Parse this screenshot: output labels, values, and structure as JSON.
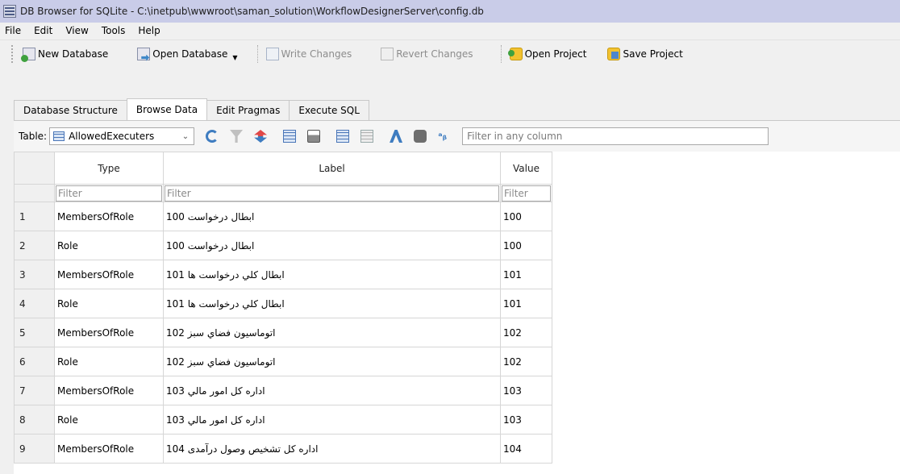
{
  "window": {
    "title": "DB Browser for SQLite - C:\\inetpub\\wwwroot\\saman_solution\\WorkflowDesignerServer\\config.db"
  },
  "menu": [
    "File",
    "Edit",
    "View",
    "Tools",
    "Help"
  ],
  "toolbar": {
    "new_database": "New Database",
    "open_database": "Open Database",
    "write_changes": "Write Changes",
    "revert_changes": "Revert Changes",
    "open_project": "Open Project",
    "save_project": "Save Project"
  },
  "tabs": [
    "Database Structure",
    "Browse Data",
    "Edit Pragmas",
    "Execute SQL"
  ],
  "active_tab": "Browse Data",
  "browse": {
    "table_label": "Table:",
    "table_selected": "AllowedExecuters",
    "filter_any_placeholder": "Filter in any column"
  },
  "grid": {
    "columns": [
      "Type",
      "Label",
      "Value"
    ],
    "filter_placeholder": "Filter",
    "rows": [
      {
        "num": "1",
        "type": "MembersOfRole",
        "label": "ابطال درخواست 100",
        "value": "100"
      },
      {
        "num": "2",
        "type": "Role",
        "label": "ابطال درخواست 100",
        "value": "100"
      },
      {
        "num": "3",
        "type": "MembersOfRole",
        "label": "ابطال کلي درخواست ها 101",
        "value": "101"
      },
      {
        "num": "4",
        "type": "Role",
        "label": "ابطال کلي درخواست ها 101",
        "value": "101"
      },
      {
        "num": "5",
        "type": "MembersOfRole",
        "label": "اتوماسيون فضاي سبز 102",
        "value": "102"
      },
      {
        "num": "6",
        "type": "Role",
        "label": "اتوماسيون فضاي سبز 102",
        "value": "102"
      },
      {
        "num": "7",
        "type": "MembersOfRole",
        "label": "اداره کل امور مالي 103",
        "value": "103"
      },
      {
        "num": "8",
        "type": "Role",
        "label": "اداره کل امور مالي 103",
        "value": "103"
      },
      {
        "num": "9",
        "type": "MembersOfRole",
        "label": "اداره کل تشخيص وصول درآمدی 104",
        "value": "104"
      }
    ]
  }
}
